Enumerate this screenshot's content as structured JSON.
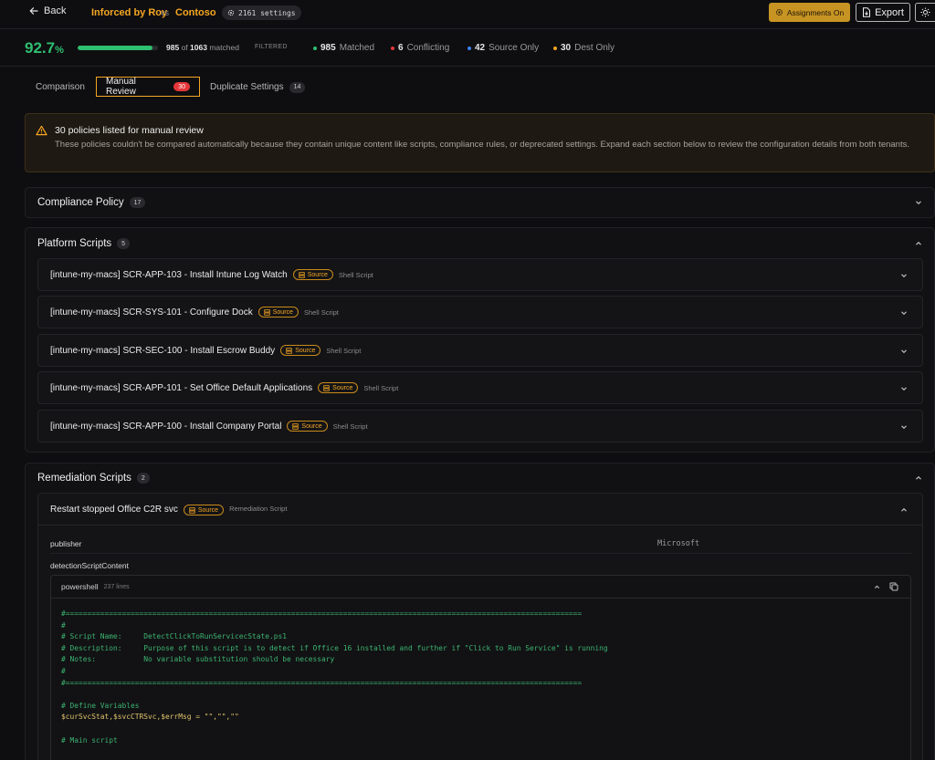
{
  "header": {
    "back_label": "Back",
    "source_tenant": "Inforced by Roy",
    "vs_label": "vs",
    "dest_tenant": "Contoso",
    "settings_count": "2161 settings",
    "assignments_label": "Assignments On",
    "export_label": "Export"
  },
  "stats": {
    "match_percent": "92.7",
    "percent_sign": "%",
    "progress_fraction": 0.927,
    "matched_num": "985",
    "of_label": "of",
    "matched_total": "1063",
    "matched_suffix": "matched",
    "filtered_label": "FILTERED",
    "legend": [
      {
        "count": "985",
        "label": "Matched",
        "color": "#2fbf71"
      },
      {
        "count": "6",
        "label": "Conflicting",
        "color": "#e5373a"
      },
      {
        "count": "42",
        "label": "Source Only",
        "color": "#3b82f6"
      },
      {
        "count": "30",
        "label": "Dest Only",
        "color": "#f5a623"
      }
    ]
  },
  "tabs": [
    {
      "label": "Comparison",
      "badge": ""
    },
    {
      "label": "Manual Review",
      "badge": "30"
    },
    {
      "label": "Duplicate Settings",
      "badge": "14"
    }
  ],
  "alert": {
    "title": "30 policies listed for manual review",
    "description": "These policies couldn't be compared automatically because they contain unique content like scripts, compliance rules, or deprecated settings. Expand each section below to review the configuration details from both tenants."
  },
  "sections": {
    "compliance": {
      "title": "Compliance Policy",
      "count": "17"
    },
    "platform": {
      "title": "Platform Scripts",
      "count": "5"
    },
    "remediation": {
      "title": "Remediation Scripts",
      "count": "2"
    }
  },
  "platform_items": [
    {
      "name": "[intune-my-macs] SCR-APP-103 - Install Intune Log Watch",
      "badge": "Source",
      "type": "Shell Script"
    },
    {
      "name": "[intune-my-macs] SCR-SYS-101 - Configure Dock",
      "badge": "Source",
      "type": "Shell Script"
    },
    {
      "name": "[intune-my-macs] SCR-SEC-100 - Install Escrow Buddy",
      "badge": "Source",
      "type": "Shell Script"
    },
    {
      "name": "[intune-my-macs] SCR-APP-101 - Set Office Default Applications",
      "badge": "Source",
      "type": "Shell Script"
    },
    {
      "name": "[intune-my-macs] SCR-APP-100 - Install Company Portal",
      "badge": "Source",
      "type": "Shell Script"
    }
  ],
  "remediation_item": {
    "name": "Restart stopped Office C2R svc",
    "badge": "Source",
    "type": "Remediation Script",
    "publisher_key": "publisher",
    "publisher_val": "Microsoft",
    "detection_key": "detectionScriptContent"
  },
  "code": {
    "language": "powershell",
    "lines_label": "237 lines",
    "lines": [
      "#=======================================================================================================================",
      "#",
      "# Script Name:     DetectClickToRunServicecState.ps1",
      "# Description:     Purpose of this script is to detect if Office 16 installed and further if \"Click to Run Service\" is running",
      "# Notes:           No variable substitution should be necessary",
      "#",
      "#=======================================================================================================================",
      "",
      "# Define Variables",
      "$curSvcStat,$svcCTRSvc,$errMsg = \"\",\"\",\"\"",
      "",
      "# Main script"
    ]
  }
}
